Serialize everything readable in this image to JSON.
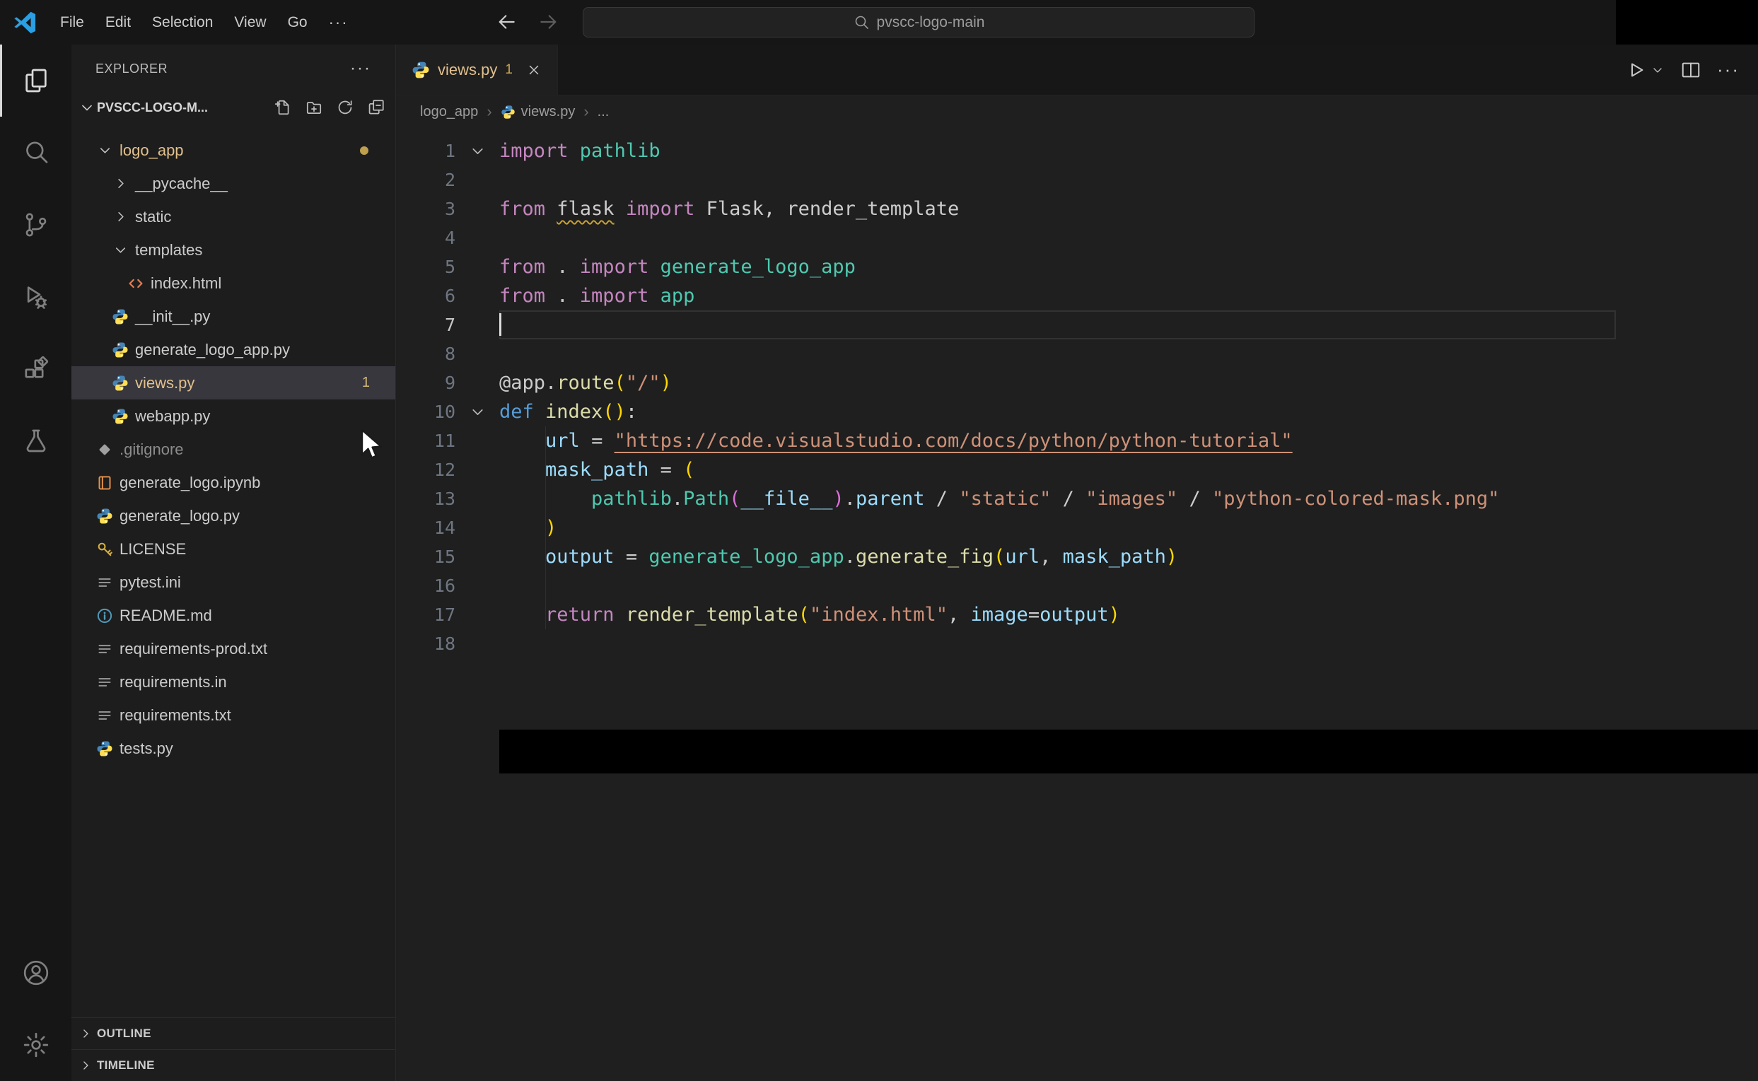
{
  "colors": {
    "git_modified": "#e2c08d",
    "warning_badge": "#d7ba7d",
    "selected_row": "#37373d"
  },
  "icons": {
    "logo": "vscode-logo-icon",
    "back": "arrow-left-icon",
    "forward": "arrow-right-icon",
    "search": "search-icon",
    "workspace_twisty": "chevron-down-icon",
    "panel_twisty": "chevron-right-icon",
    "tab_file": "python-icon",
    "tab_close": "close-icon",
    "run": "run-icon",
    "run_dropdown": "chevron-down-icon",
    "split_editor": "split-icon",
    "breadcrumb_file": "python-icon"
  },
  "title_bar": {
    "menus": [
      "File",
      "Edit",
      "Selection",
      "View",
      "Go"
    ],
    "more_label": "···",
    "search_text": "pvscc-logo-main"
  },
  "activity_bar": {
    "top": [
      {
        "id": "explorer",
        "icon": "files-icon",
        "active": true
      },
      {
        "id": "search",
        "icon": "search-icon",
        "active": false
      },
      {
        "id": "source-control",
        "icon": "source-control-icon",
        "active": false
      },
      {
        "id": "run-and-debug",
        "icon": "debug-icon",
        "active": false
      },
      {
        "id": "extensions",
        "icon": "extensions-icon",
        "active": false
      },
      {
        "id": "testing",
        "icon": "beaker-icon",
        "active": false
      }
    ],
    "bottom": [
      {
        "id": "accounts",
        "icon": "account-icon",
        "active": false
      },
      {
        "id": "settings",
        "icon": "gear-icon",
        "active": false
      }
    ]
  },
  "explorer": {
    "title": "EXPLORER",
    "more_label": "···",
    "workspace": "PVSCC-LOGO-M...",
    "toolbar": [
      {
        "id": "new-file",
        "icon": "new-file-icon"
      },
      {
        "id": "new-folder",
        "icon": "new-folder-icon"
      },
      {
        "id": "refresh-explorer",
        "icon": "refresh-icon"
      },
      {
        "id": "collapse-folders",
        "icon": "collapse-all-icon"
      }
    ],
    "tree": [
      {
        "label": "logo_app",
        "level": 0,
        "kind": "folder",
        "expanded": true,
        "color": "modified",
        "dot": true
      },
      {
        "label": "__pycache__",
        "level": 1,
        "kind": "folder",
        "expanded": false
      },
      {
        "label": "static",
        "level": 1,
        "kind": "folder",
        "expanded": false
      },
      {
        "label": "templates",
        "level": 1,
        "kind": "folder",
        "expanded": true
      },
      {
        "label": "index.html",
        "level": 2,
        "kind": "file",
        "icon": "html-icon"
      },
      {
        "label": "__init__.py",
        "level": 1,
        "kind": "file",
        "icon": "python-icon"
      },
      {
        "label": "generate_logo_app.py",
        "level": 1,
        "kind": "file",
        "icon": "python-icon"
      },
      {
        "label": "views.py",
        "level": 1,
        "kind": "file",
        "icon": "python-icon",
        "selected": true,
        "color": "modified",
        "badge": "1"
      },
      {
        "label": "webapp.py",
        "level": 1,
        "kind": "file",
        "icon": "python-icon"
      },
      {
        "label": ".gitignore",
        "level": 0,
        "kind": "file",
        "icon": "git-icon",
        "color": "ignored"
      },
      {
        "label": "generate_logo.ipynb",
        "level": 0,
        "kind": "file",
        "icon": "notebook-icon"
      },
      {
        "label": "generate_logo.py",
        "level": 0,
        "kind": "file",
        "icon": "python-icon"
      },
      {
        "label": "LICENSE",
        "level": 0,
        "kind": "file",
        "icon": "key-icon"
      },
      {
        "label": "pytest.ini",
        "level": 0,
        "kind": "file",
        "icon": "list-icon"
      },
      {
        "label": "README.md",
        "level": 0,
        "kind": "file",
        "icon": "info-icon"
      },
      {
        "label": "requirements-prod.txt",
        "level": 0,
        "kind": "file",
        "icon": "list-icon"
      },
      {
        "label": "requirements.in",
        "level": 0,
        "kind": "file",
        "icon": "list-icon"
      },
      {
        "label": "requirements.txt",
        "level": 0,
        "kind": "file",
        "icon": "list-icon"
      },
      {
        "label": "tests.py",
        "level": 0,
        "kind": "file",
        "icon": "python-icon"
      }
    ],
    "panels": [
      "OUTLINE",
      "TIMELINE"
    ]
  },
  "editor": {
    "tab": {
      "label": "views.py",
      "badge": "1"
    },
    "actions_more_label": "···",
    "breadcrumb": [
      "logo_app",
      "views.py",
      "..."
    ],
    "breadcrumb_sep": "›",
    "code": {
      "active_line": 7,
      "cursor_line": 7,
      "folds": [
        1,
        10
      ],
      "lines": [
        {
          "n": 1,
          "tokens": [
            [
              "k",
              "import "
            ],
            [
              "t",
              "pathlib"
            ]
          ]
        },
        {
          "n": 2,
          "tokens": []
        },
        {
          "n": 3,
          "tokens": [
            [
              "k",
              "from "
            ],
            [
              "w",
              "flask"
            ],
            [
              "k",
              " import "
            ],
            [
              "p",
              "Flask, render_template"
            ]
          ]
        },
        {
          "n": 4,
          "tokens": []
        },
        {
          "n": 5,
          "tokens": [
            [
              "k",
              "from "
            ],
            [
              "p",
              ". "
            ],
            [
              "k",
              "import "
            ],
            [
              "t",
              "generate_logo_app"
            ]
          ]
        },
        {
          "n": 6,
          "tokens": [
            [
              "k",
              "from "
            ],
            [
              "p",
              ". "
            ],
            [
              "k",
              "import "
            ],
            [
              "t",
              "app"
            ]
          ]
        },
        {
          "n": 7,
          "tokens": []
        },
        {
          "n": 8,
          "tokens": []
        },
        {
          "n": 9,
          "tokens": [
            [
              "p",
              "@app."
            ],
            [
              "f",
              "route"
            ],
            [
              "g",
              "("
            ],
            [
              "s",
              "\"/\""
            ],
            [
              "g",
              ")"
            ]
          ]
        },
        {
          "n": 10,
          "tokens": [
            [
              "d",
              "def "
            ],
            [
              "f",
              "index"
            ],
            [
              "g",
              "()"
            ],
            [
              "p",
              ":"
            ]
          ]
        },
        {
          "n": 11,
          "tokens": [
            [
              "p",
              "    "
            ],
            [
              "v",
              "url"
            ],
            [
              "p",
              " = "
            ],
            [
              "u",
              "\"https://code.visualstudio.com/docs/python/python-tutorial\""
            ]
          ]
        },
        {
          "n": 12,
          "tokens": [
            [
              "p",
              "    "
            ],
            [
              "v",
              "mask_path"
            ],
            [
              "p",
              " = "
            ],
            [
              "g",
              "("
            ]
          ]
        },
        {
          "n": 13,
          "tokens": [
            [
              "p",
              "        "
            ],
            [
              "t",
              "pathlib"
            ],
            [
              "p",
              "."
            ],
            [
              "t",
              "Path"
            ],
            [
              "m",
              "("
            ],
            [
              "v",
              "__file__"
            ],
            [
              "m",
              ")"
            ],
            [
              "p",
              "."
            ],
            [
              "v",
              "parent"
            ],
            [
              "p",
              " / "
            ],
            [
              "s",
              "\"static\""
            ],
            [
              "p",
              " / "
            ],
            [
              "s",
              "\"images\""
            ],
            [
              "p",
              " / "
            ],
            [
              "s",
              "\"python-colored-mask.png\""
            ]
          ]
        },
        {
          "n": 14,
          "tokens": [
            [
              "p",
              "    "
            ],
            [
              "g",
              ")"
            ]
          ]
        },
        {
          "n": 15,
          "tokens": [
            [
              "p",
              "    "
            ],
            [
              "v",
              "output"
            ],
            [
              "p",
              " = "
            ],
            [
              "t",
              "generate_logo_app"
            ],
            [
              "p",
              "."
            ],
            [
              "f",
              "generate_fig"
            ],
            [
              "g",
              "("
            ],
            [
              "v",
              "url"
            ],
            [
              "p",
              ", "
            ],
            [
              "v",
              "mask_path"
            ],
            [
              "g",
              ")"
            ]
          ]
        },
        {
          "n": 16,
          "tokens": []
        },
        {
          "n": 17,
          "tokens": [
            [
              "p",
              "    "
            ],
            [
              "k",
              "return "
            ],
            [
              "f",
              "render_template"
            ],
            [
              "g",
              "("
            ],
            [
              "s",
              "\"index.html\""
            ],
            [
              "p",
              ", "
            ],
            [
              "v",
              "image"
            ],
            [
              "p",
              "="
            ],
            [
              "v",
              "output"
            ],
            [
              "g",
              ")"
            ]
          ]
        },
        {
          "n": 18,
          "tokens": []
        }
      ]
    }
  }
}
